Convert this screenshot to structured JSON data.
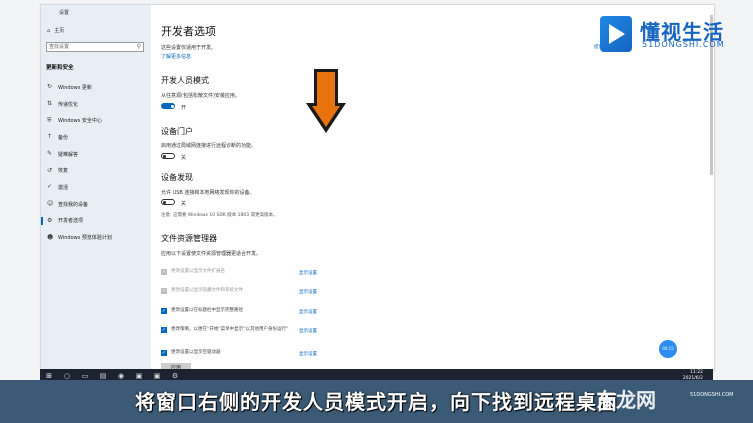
{
  "sidebar": {
    "title": "设置",
    "home": "主页",
    "search_placeholder": "查找设置",
    "section": "更新和安全",
    "items": [
      {
        "label": "Windows 更新",
        "icon": "refresh-icon"
      },
      {
        "label": "传递优化",
        "icon": "delivery-icon"
      },
      {
        "label": "Windows 安全中心",
        "icon": "shield-icon"
      },
      {
        "label": "备份",
        "icon": "backup-icon"
      },
      {
        "label": "疑难解答",
        "icon": "wrench-icon"
      },
      {
        "label": "恢复",
        "icon": "recovery-icon"
      },
      {
        "label": "激活",
        "icon": "check-circle-icon"
      },
      {
        "label": "查找我的设备",
        "icon": "person-icon"
      },
      {
        "label": "开发者选项",
        "icon": "developer-icon"
      },
      {
        "label": "Windows 预览体验计划",
        "icon": "smiley-icon"
      }
    ]
  },
  "main": {
    "title": "开发者选项",
    "desc": "这些设置仅适用于开发。",
    "learn_more": "了解更多信息",
    "dev_mode": {
      "title": "开发人员模式",
      "desc": "从任意源(包括松散文件)安装应用。",
      "state": "开"
    },
    "portal": {
      "title": "设备门户",
      "desc": "启用通过局域网连接进行远程诊断的功能。",
      "state": "关"
    },
    "discovery": {
      "title": "设备发现",
      "desc": "允许 USB 连接和本地网络发现你的设备。",
      "state": "关",
      "note": "注意: 这需要 Windows 10 SDK 版本 1803 或更高版本。"
    },
    "explorer": {
      "title": "文件资源管理器",
      "desc": "应用以下设置使文件资源管理器更适合开发。",
      "options": [
        {
          "label": "更改设置以显示文件扩展名",
          "show": "显示设置",
          "checked": "gray"
        },
        {
          "label": "更改设置以显示隐藏文件和系统文件",
          "show": "显示设置",
          "checked": "gray"
        },
        {
          "label": "更改设置以在标题栏中显示完整路径",
          "show": "显示设置",
          "checked": "blue"
        },
        {
          "label": "更改策略，以便在“开始”菜单中显示“以其他用户身份运行”",
          "show": "显示设置",
          "checked": "blue"
        },
        {
          "label": "更改设置以显示空驱动器",
          "show": "显示设置",
          "checked": "blue"
        }
      ],
      "apply": "应用"
    },
    "right_link": "提供反馈"
  },
  "logo": {
    "name": "懂视生活",
    "domain": "51DONGSHI.COM"
  },
  "taskbar": {
    "time": "11:22",
    "date": "2021/6/2"
  },
  "subtitle": "将窗口右侧的开发人员模式开启，向下找到远程桌面",
  "watermark": {
    "name": "东龙网",
    "domain": "51DONGSHI.COM"
  },
  "fab_label": "00:15"
}
